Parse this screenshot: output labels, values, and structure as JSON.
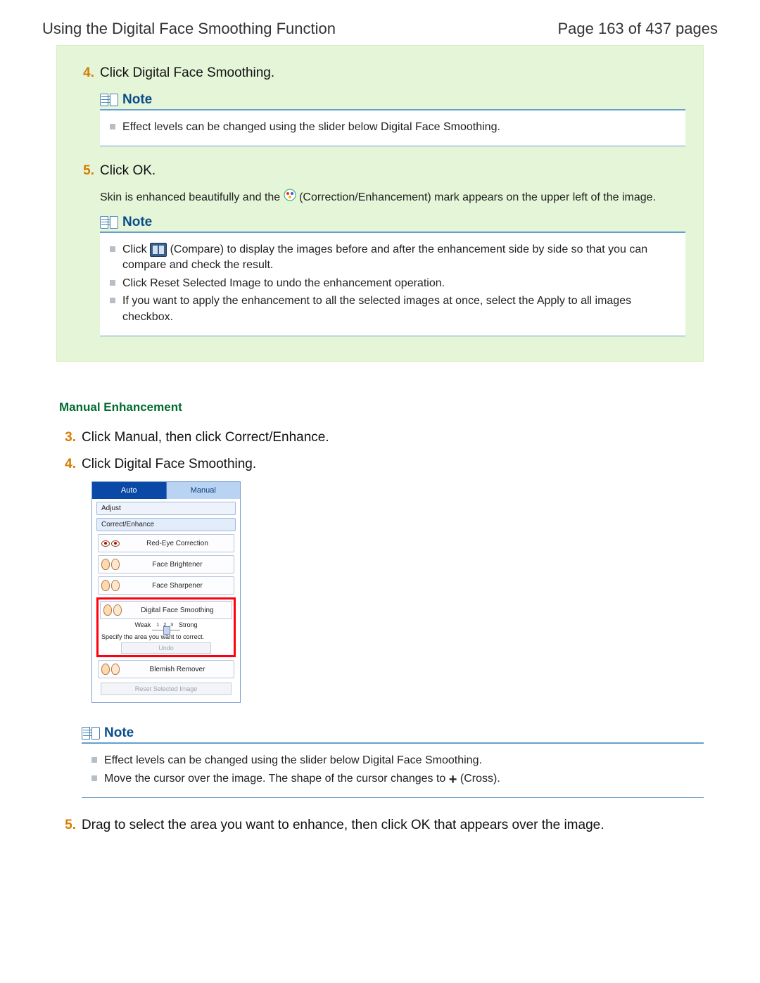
{
  "header": {
    "title": "Using the Digital Face Smoothing Function",
    "page": "Page 163 of 437 pages"
  },
  "green": {
    "step4": {
      "num": "4.",
      "text": "Click Digital Face Smoothing."
    },
    "note1": {
      "label": "Note",
      "item": "Effect levels can be changed using the slider below Digital Face Smoothing."
    },
    "step5": {
      "num": "5.",
      "text": "Click OK.",
      "sub_a": "Skin is enhanced beautifully and the ",
      "sub_b": " (Correction/Enhancement) mark appears on the upper left of the image."
    },
    "note2": {
      "label": "Note",
      "item1a": "Click ",
      "item1b": " (Compare) to display the images before and after the enhancement side by side so that you can compare and check the result.",
      "item2": "Click Reset Selected Image to undo the enhancement operation.",
      "item3": "If you want to apply the enhancement to all the selected images at once, select the Apply to all images checkbox."
    }
  },
  "manual": {
    "heading": "Manual Enhancement",
    "step3": {
      "num": "3.",
      "text": "Click Manual, then click Correct/Enhance."
    },
    "step4": {
      "num": "4.",
      "text": "Click Digital Face Smoothing."
    },
    "ui": {
      "tabAuto": "Auto",
      "tabManual": "Manual",
      "adjust": "Adjust",
      "correct": "Correct/Enhance",
      "redeye": "Red-Eye Correction",
      "bright": "Face Brightener",
      "sharp": "Face Sharpener",
      "dfs": "Digital Face Smoothing",
      "weak": "Weak",
      "strong": "Strong",
      "t1": "1",
      "t2": "2",
      "t3": "3",
      "specify": "Specify the area you want to correct.",
      "undo": "Undo",
      "blemish": "Blemish Remover",
      "reset": "Reset Selected Image"
    },
    "note": {
      "label": "Note",
      "item1": "Effect levels can be changed using the slider below Digital Face Smoothing.",
      "item2a": "Move the cursor over the image. The shape of the cursor changes to ",
      "item2b": " (Cross)."
    },
    "step5": {
      "num": "5.",
      "text": "Drag to select the area you want to enhance, then click OK that appears over the image."
    }
  }
}
